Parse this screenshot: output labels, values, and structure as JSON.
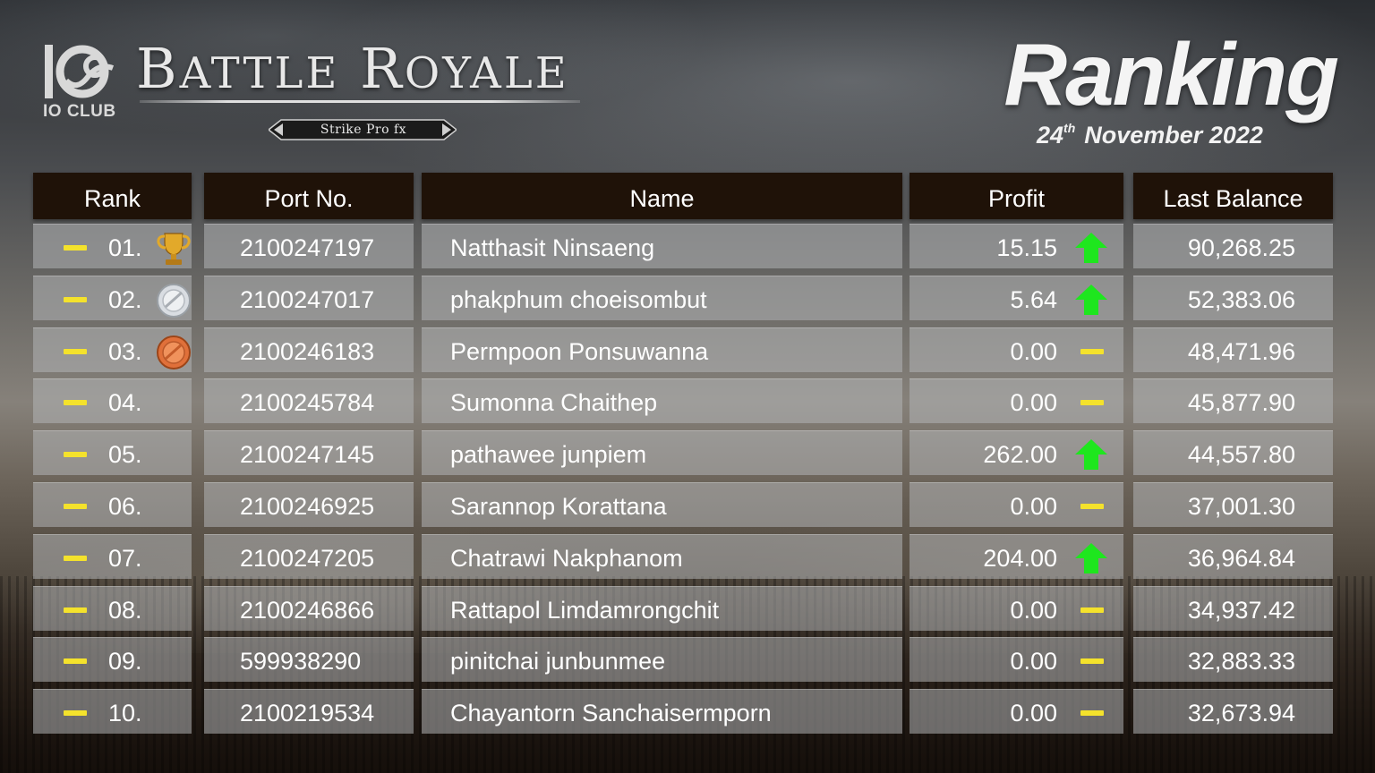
{
  "brand": {
    "club_label": "IO CLUB",
    "title_first_initial": "B",
    "title_first_rest": "ATTLE",
    "title_second_initial": "R",
    "title_second_rest": "OYALE",
    "subtitle": "Strike Pro fx"
  },
  "header": {
    "title": "Ranking",
    "date_day": "24",
    "date_suffix": "th",
    "date_rest": "November 2022"
  },
  "table": {
    "columns": {
      "rank": "Rank",
      "port": "Port No.",
      "name": "Name",
      "profit": "Profit",
      "balance": "Last Balance"
    },
    "rows": [
      {
        "rank": "01.",
        "medal": "trophy-icon",
        "port": "2100247197",
        "name": "Natthasit Ninsaeng",
        "profit": "15.15",
        "trend": "up",
        "balance": "90,268.25"
      },
      {
        "rank": "02.",
        "medal": "silver-medal-icon",
        "port": "2100247017",
        "name": "phakphum choeisombut",
        "profit": "5.64",
        "trend": "up",
        "balance": "52,383.06"
      },
      {
        "rank": "03.",
        "medal": "bronze-medal-icon",
        "port": "2100246183",
        "name": "Permpoon Ponsuwanna",
        "profit": "0.00",
        "trend": "same",
        "balance": "48,471.96"
      },
      {
        "rank": "04.",
        "medal": "",
        "port": "2100245784",
        "name": "Sumonna Chaithep",
        "profit": "0.00",
        "trend": "same",
        "balance": "45,877.90"
      },
      {
        "rank": "05.",
        "medal": "",
        "port": "2100247145",
        "name": "pathawee junpiem",
        "profit": "262.00",
        "trend": "up",
        "balance": "44,557.80"
      },
      {
        "rank": "06.",
        "medal": "",
        "port": "2100246925",
        "name": "Sarannop Korattana",
        "profit": "0.00",
        "trend": "same",
        "balance": "37,001.30"
      },
      {
        "rank": "07.",
        "medal": "",
        "port": "2100247205",
        "name": "Chatrawi Nakphanom",
        "profit": "204.00",
        "trend": "up",
        "balance": "36,964.84"
      },
      {
        "rank": "08.",
        "medal": "",
        "port": "2100246866",
        "name": "Rattapol Limdamrongchit",
        "profit": "0.00",
        "trend": "same",
        "balance": "34,937.42"
      },
      {
        "rank": "09.",
        "medal": "",
        "port": "599938290",
        "name": "pinitchai junbunmee",
        "profit": "0.00",
        "trend": "same",
        "balance": "32,883.33"
      },
      {
        "rank": "10.",
        "medal": "",
        "port": "2100219534",
        "name": "Chayantorn Sanchaisermporn",
        "profit": "0.00",
        "trend": "same",
        "balance": "32,673.94"
      }
    ]
  },
  "colors": {
    "header_bg": "#1f1208",
    "trend_up": "#1ee61e",
    "trend_same": "#f4e22c",
    "row_bg": "rgba(178,180,182,0.55)"
  }
}
